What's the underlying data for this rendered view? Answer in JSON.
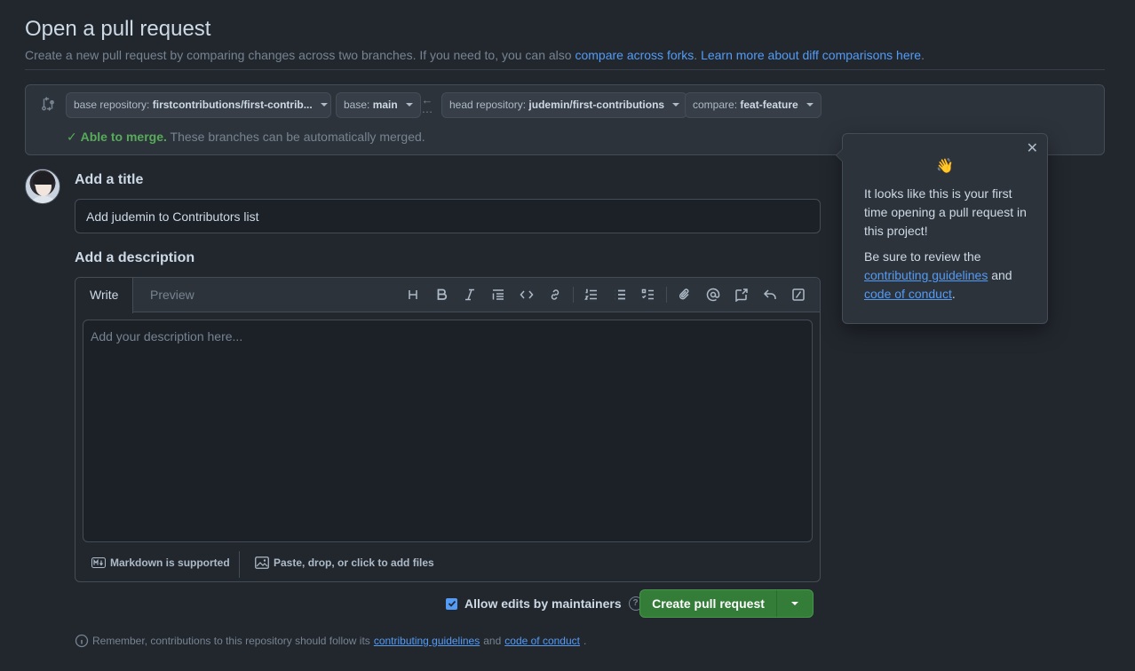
{
  "header": {
    "title": "Open a pull request",
    "subtitle_text": "Create a new pull request by comparing changes across two branches. If you need to, you can also",
    "link_forks": "compare across forks",
    "link_learn": "Learn more about diff comparisons here"
  },
  "compare": {
    "base_repo_label": "base repository:",
    "base_repo_value": "firstcontributions/first-contrib...",
    "base_label": "base:",
    "base_value": "main",
    "head_repo_label": "head repository:",
    "head_repo_value": "judemin/first-contributions",
    "compare_label": "compare:",
    "compare_value": "feat-feature",
    "merge_ok": "Able to merge.",
    "merge_text": "These branches can be automatically merged."
  },
  "form": {
    "title_label": "Add a title",
    "title_value": "Add judemin to Contributors list",
    "desc_label": "Add a description",
    "tab_write": "Write",
    "tab_preview": "Preview",
    "desc_placeholder": "Add your description here...",
    "markdown_note": "Markdown is supported",
    "attach_note": "Paste, drop, or click to add files",
    "allow_edits": "Allow edits by maintainers",
    "create_button": "Create pull request"
  },
  "reminder": {
    "text": "Remember, contributions to this repository should follow its",
    "link_guidelines": "contributing guidelines",
    "and": "and",
    "link_conduct": "code of conduct",
    "end": "."
  },
  "popover": {
    "wave": "👋",
    "text1": "It looks like this is your first time opening a pull request in this project!",
    "text2_prefix": "Be sure to review the",
    "link_guidelines": "contributing guidelines",
    "and": "and",
    "link_conduct": "code of conduct",
    "end": ".",
    "close": "✕"
  },
  "colors": {
    "background": "#22272e",
    "accent_link": "#539bf5",
    "success": "#57ab5a",
    "button_green": "#347d39"
  }
}
